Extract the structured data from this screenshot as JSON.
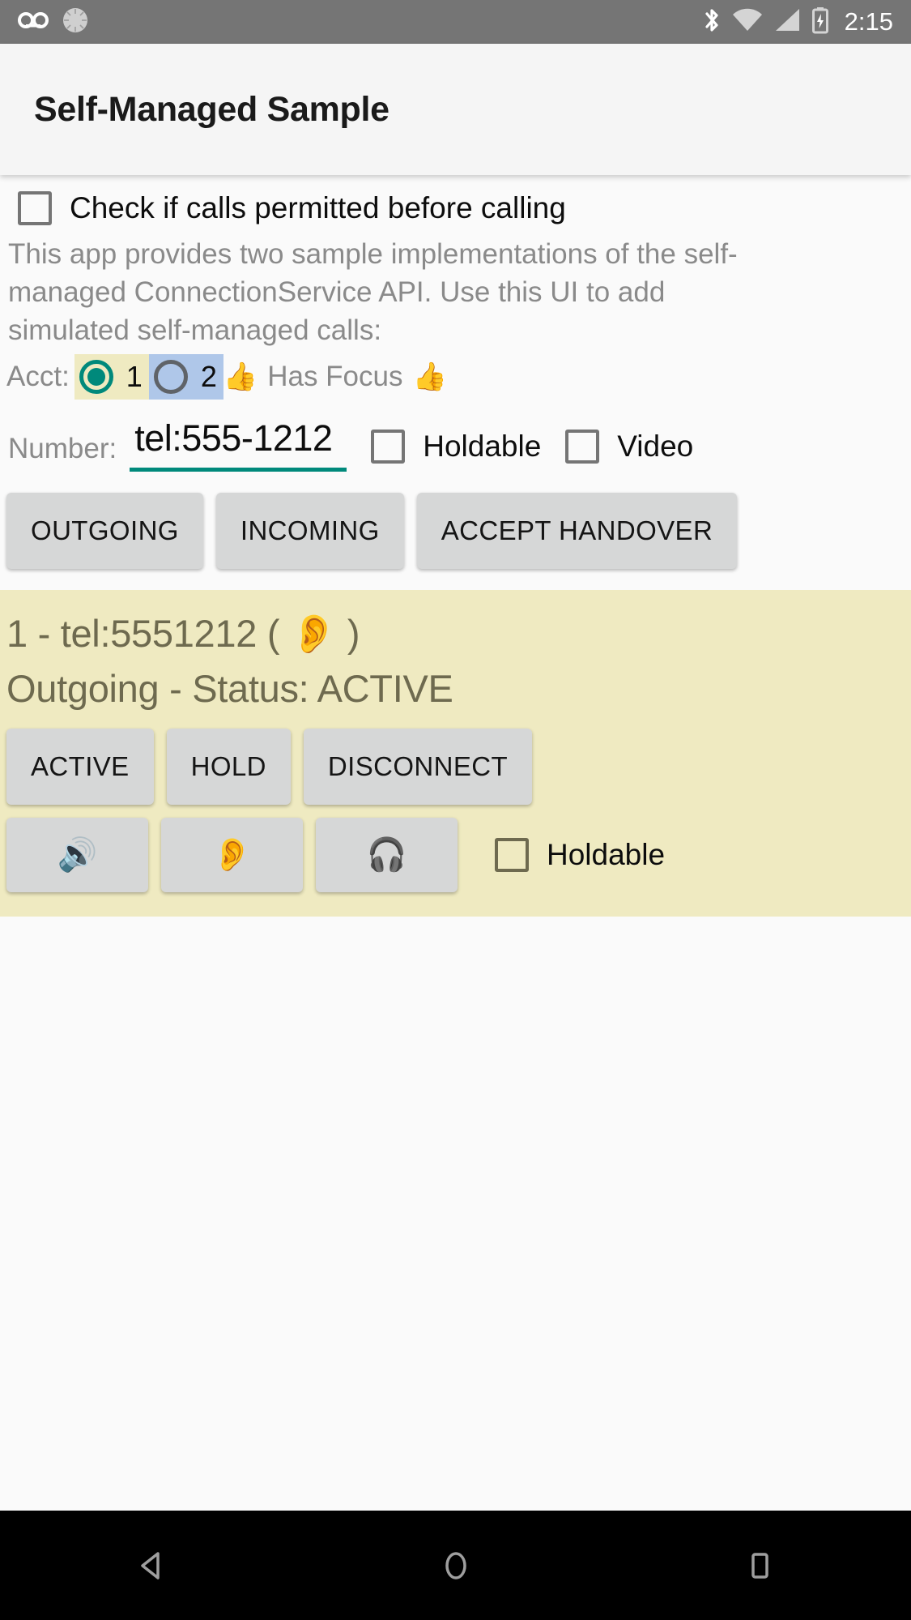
{
  "status_bar": {
    "background": "#757575",
    "time": "2:15",
    "left_icons": [
      "voicemail-icon",
      "sync-spinner-icon"
    ],
    "right_icons": [
      "bluetooth-icon",
      "wifi-icon",
      "cellular-signal-icon",
      "battery-charging-icon"
    ]
  },
  "app_bar": {
    "title": "Self-Managed Sample",
    "background": "#f5f5f5"
  },
  "permit_check": {
    "label": "Check if calls permitted before calling",
    "checked": false
  },
  "description": "This app provides two sample implementations of the self-managed ConnectionService API.  Use this UI to add simulated self-managed calls:",
  "account": {
    "label": "Acct:",
    "options": [
      {
        "value": "1",
        "selected": true,
        "chip_color": "#efeac1",
        "radio_color": "#00897b"
      },
      {
        "value": "2",
        "selected": false,
        "chip_color": "#afc7e9",
        "radio_color": "#5f6368"
      }
    ],
    "focus_text": "Has Focus",
    "focus_emoji_left": "👍",
    "focus_emoji_right": "👍"
  },
  "number": {
    "label": "Number:",
    "value": "tel:555-1212",
    "placeholder": "tel:555-1212",
    "underline_color": "#00897b",
    "holdable": {
      "label": "Holdable",
      "checked": false
    },
    "video": {
      "label": "Video",
      "checked": false
    }
  },
  "action_buttons": [
    {
      "label": "OUTGOING",
      "name": "outgoing-button"
    },
    {
      "label": "INCOMING",
      "name": "incoming-button"
    },
    {
      "label": "ACCEPT HANDOVER",
      "name": "accept-handover-button"
    }
  ],
  "call_card": {
    "background": "#efeac1",
    "text_color": "#6e6a4f",
    "title": "1 - tel:5551212 ( 👂 )",
    "status": "Outgoing - Status: ACTIVE",
    "state_buttons": [
      {
        "label": "ACTIVE",
        "name": "call-active-button"
      },
      {
        "label": "HOLD",
        "name": "call-hold-button"
      },
      {
        "label": "DISCONNECT",
        "name": "call-disconnect-button"
      }
    ],
    "audio_buttons": [
      {
        "icon": "🔊",
        "name": "audio-route-speaker-button"
      },
      {
        "icon": "👂",
        "name": "audio-route-earpiece-button"
      },
      {
        "icon": "🎧",
        "name": "audio-route-headset-button"
      }
    ],
    "holdable": {
      "label": "Holdable",
      "checked": false
    }
  },
  "nav_bar": {
    "background": "#000000",
    "buttons": [
      "back-nav-button",
      "home-nav-button",
      "recents-nav-button"
    ]
  }
}
